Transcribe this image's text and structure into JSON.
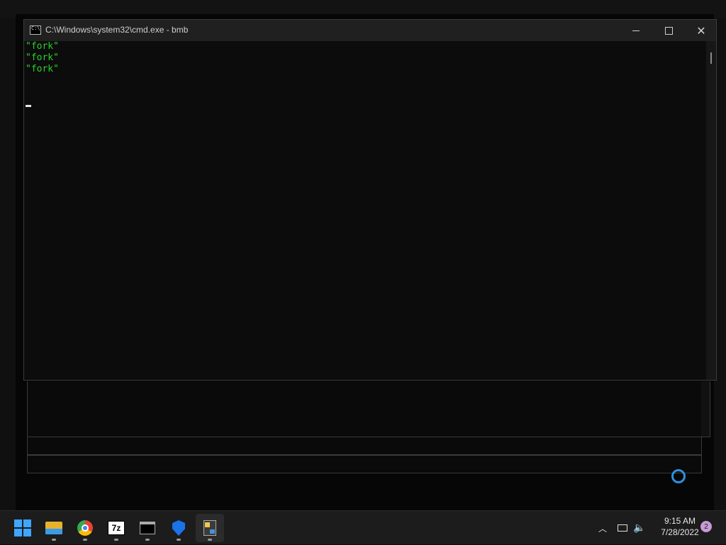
{
  "window": {
    "title": "C:\\Windows\\system32\\cmd.exe - bmb",
    "icon": "cmd-icon"
  },
  "console": {
    "lines": [
      "\"fork\"",
      "\"fork\"",
      "\"fork\""
    ],
    "text_color": "#2bd02b",
    "background": "#0c0c0c"
  },
  "taskbar": {
    "apps": [
      {
        "name": "Start",
        "icon": "windows-start-icon"
      },
      {
        "name": "File Explorer",
        "icon": "folder-icon"
      },
      {
        "name": "Google Chrome",
        "icon": "chrome-icon"
      },
      {
        "name": "7-Zip",
        "icon": "7zip-icon",
        "label": "7z"
      },
      {
        "name": "Command Prompt",
        "icon": "terminal-icon"
      },
      {
        "name": "Windows Security",
        "icon": "shield-icon"
      },
      {
        "name": "Python",
        "icon": "python-icon"
      }
    ],
    "time": "9:15 AM",
    "date": "7/28/2022",
    "notification_count": "2",
    "accent": "#3fa6ff"
  }
}
